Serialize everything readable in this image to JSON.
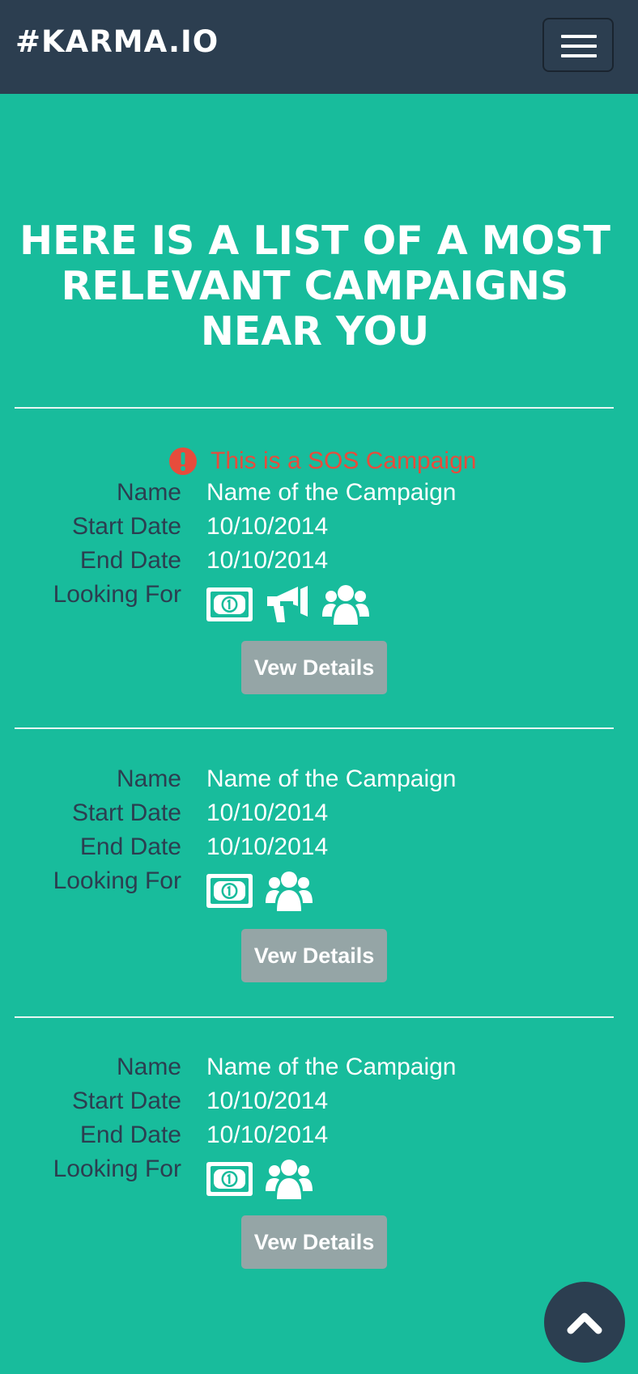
{
  "navbar": {
    "brand": "#KARMA.IO",
    "menu_icon": "hamburger-icon"
  },
  "headline": "HERE IS A LIST OF A MOST RELEVANT CAMPAIGNS NEAR YOU",
  "labels": {
    "name": "Name",
    "start_date": "Start Date",
    "end_date": "End Date",
    "looking_for": "Looking For"
  },
  "campaigns": [
    {
      "sos": true,
      "sos_text": "This is a SOS Campaign",
      "name": "Name of the Campaign",
      "start_date": "10/10/2014",
      "end_date": "10/10/2014",
      "looking_for": [
        "money-icon",
        "megaphone-icon",
        "users-icon"
      ],
      "button": "Vew Details"
    },
    {
      "sos": false,
      "name": "Name of the Campaign",
      "start_date": "10/10/2014",
      "end_date": "10/10/2014",
      "looking_for": [
        "money-icon",
        "users-icon"
      ],
      "button": "Vew Details"
    },
    {
      "sos": false,
      "name": "Name of the Campaign",
      "start_date": "10/10/2014",
      "end_date": "10/10/2014",
      "looking_for": [
        "money-icon",
        "users-icon"
      ],
      "button": "Vew Details"
    }
  ],
  "scroll_top_icon": "chevron-up-icon",
  "colors": {
    "background": "#18bc9c",
    "navbar": "#2c3e50",
    "sos": "#e74c3c",
    "button": "#95a5a6",
    "label": "#2c3e50"
  }
}
